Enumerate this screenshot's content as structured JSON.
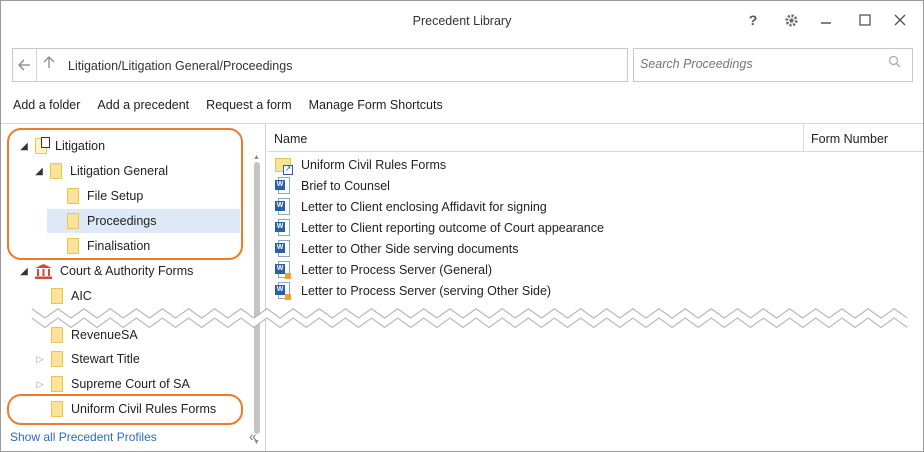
{
  "window": {
    "title": "Precedent Library",
    "help_label": "?",
    "gear_icon": "gear-icon",
    "minimize_icon": "minimize-icon",
    "maximize_icon": "maximize-icon",
    "close_icon": "close-icon"
  },
  "address": {
    "path": "Litigation/Litigation General/Proceedings"
  },
  "search": {
    "placeholder": "Search Proceedings"
  },
  "toolbar": {
    "add_folder": "Add a folder",
    "add_precedent": "Add a precedent",
    "request_form": "Request a form",
    "manage_shortcuts": "Manage Form Shortcuts"
  },
  "tree": {
    "items": [
      {
        "label": "Litigation"
      },
      {
        "label": "Litigation General"
      },
      {
        "label": "File Setup"
      },
      {
        "label": "Proceedings"
      },
      {
        "label": "Finalisation"
      },
      {
        "label": "Court & Authority Forms"
      },
      {
        "label": "AIC"
      },
      {
        "label": "RevenueSA"
      },
      {
        "label": "Stewart Title"
      },
      {
        "label": "Supreme Court of SA"
      },
      {
        "label": "Uniform Civil Rules Forms"
      }
    ],
    "show_all": "Show all Precedent Profiles"
  },
  "list": {
    "columns": [
      "Name",
      "Form Number"
    ],
    "rows": [
      {
        "name": "Uniform Civil Rules Forms",
        "form_number": ""
      },
      {
        "name": "Brief to Counsel",
        "form_number": ""
      },
      {
        "name": "Letter to Client enclosing Affidavit for signing",
        "form_number": ""
      },
      {
        "name": "Letter to Client reporting outcome of Court appearance",
        "form_number": ""
      },
      {
        "name": "Letter to Other Side serving documents",
        "form_number": ""
      },
      {
        "name": "Letter to Process Server (General)",
        "form_number": ""
      },
      {
        "name": "Letter to Process Server (serving Other Side)",
        "form_number": ""
      }
    ]
  },
  "colors": {
    "highlight": "#ec7b2a",
    "selected": "#dde9f7",
    "link": "#2b6cc4"
  }
}
